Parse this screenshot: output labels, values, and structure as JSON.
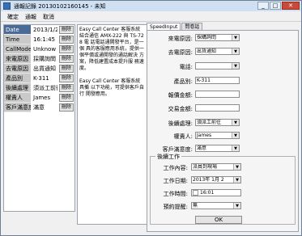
{
  "window": {
    "title": "通報記錄 20130102160145 - 未知"
  },
  "menu": [
    "確定",
    "通報",
    "取消"
  ],
  "grid": [
    {
      "key": "Date",
      "value": "2013/1/2",
      "btn": "刪除"
    },
    {
      "key": "Time",
      "value": "16:1:45",
      "btn": "刪除"
    },
    {
      "key": "CallMode",
      "value": "Unknow",
      "btn": "刪除"
    },
    {
      "key": "來電原因",
      "value": "採購詢問",
      "btn": "刪除"
    },
    {
      "key": "去電原因",
      "value": "出貨通知",
      "btn": "刪除"
    },
    {
      "key": "產品別",
      "value": "K-311",
      "btn": "刪除"
    },
    {
      "key": "後續處理",
      "value": "須派工前往",
      "btn": "刪除"
    },
    {
      "key": "權責人",
      "value": "James",
      "btn": "刪除"
    },
    {
      "key": "客戶滿意度",
      "value": "滿意",
      "btn": "刪除"
    }
  ],
  "info_text": [
    "Easy Call Center 客服系統 結合通信 AMX-222 與 TS-728 電 話電話通開發平台，是一個 具的客服應用系統，提供一 個平價或通開發的通話解決 方案，降低建置成本提升服 務速度。",
    "Easy Call Center 客服系統具備 以下功能，可提供客戶自行 開發應用。"
  ],
  "tabs": [
    "SpeedInput",
    "問卷話"
  ],
  "form": [
    {
      "label": "來電原因:",
      "value": "採購詢問",
      "dropdown": true
    },
    {
      "label": "去電原因:",
      "value": "出貨通知",
      "dropdown": true
    },
    {
      "label": "電話:",
      "value": "",
      "dropdown": true
    },
    {
      "label": "產品別:",
      "value": "K-311",
      "dropdown": false
    },
    {
      "label": "報價金額:",
      "value": "",
      "dropdown": false
    },
    {
      "label": "交易金額:",
      "value": "",
      "dropdown": false
    },
    {
      "label": "後續處理:",
      "value": "須派工前往",
      "dropdown": true
    },
    {
      "label": "權責人:",
      "value": "James",
      "dropdown": true
    },
    {
      "label": "客戶滿意度:",
      "value": "滿意",
      "dropdown": true
    }
  ],
  "followup": {
    "title": "後續工作",
    "fields": [
      {
        "label": "工作內容:",
        "value": "派員到現場",
        "dropdown": true
      },
      {
        "label": "工作日期:",
        "value": "2013年 1月 2",
        "dropdown": true
      },
      {
        "label": "工作時間:",
        "value": "16:01",
        "dropdown": false
      },
      {
        "label": "預約提醒:",
        "value": "無",
        "dropdown": true
      }
    ],
    "ok": "OK"
  }
}
